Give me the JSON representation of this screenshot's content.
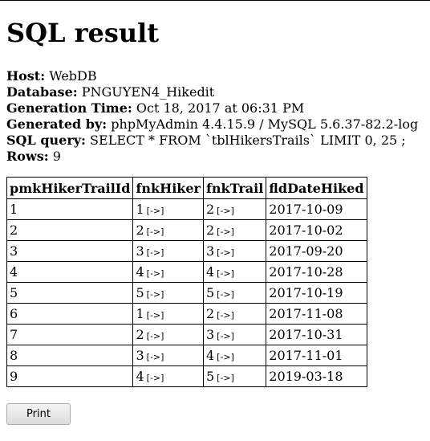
{
  "title": "SQL result",
  "meta": [
    {
      "label": "Host:",
      "value": "WebDB"
    },
    {
      "label": "Database:",
      "value": "PNGUYEN4_Hikedit"
    },
    {
      "label": "Generation Time:",
      "value": "Oct 18, 2017 at 06:31 PM"
    },
    {
      "label": "Generated by:",
      "value": "phpMyAdmin 4.4.15.9 / MySQL 5.6.37-82.2-log"
    },
    {
      "label": "SQL query:",
      "value": "SELECT * FROM `tblHikersTrails` LIMIT 0, 25 ;"
    },
    {
      "label": "Rows:",
      "value": "9"
    }
  ],
  "table": {
    "columns": [
      "pmkHikerTrailId",
      "fnkHiker",
      "fnkTrail",
      "fldDateHiked"
    ],
    "fk_link_label": "[->]",
    "rows": [
      [
        "1",
        "1",
        "2",
        "2017-10-09"
      ],
      [
        "2",
        "2",
        "2",
        "2017-10-02"
      ],
      [
        "3",
        "3",
        "3",
        "2017-09-20"
      ],
      [
        "4",
        "4",
        "4",
        "2017-10-28"
      ],
      [
        "5",
        "5",
        "5",
        "2017-10-19"
      ],
      [
        "6",
        "1",
        "2",
        "2017-11-08"
      ],
      [
        "7",
        "2",
        "3",
        "2017-10-31"
      ],
      [
        "8",
        "3",
        "4",
        "2017-11-01"
      ],
      [
        "9",
        "4",
        "5",
        "2019-03-18"
      ]
    ]
  },
  "print_label": "Print"
}
